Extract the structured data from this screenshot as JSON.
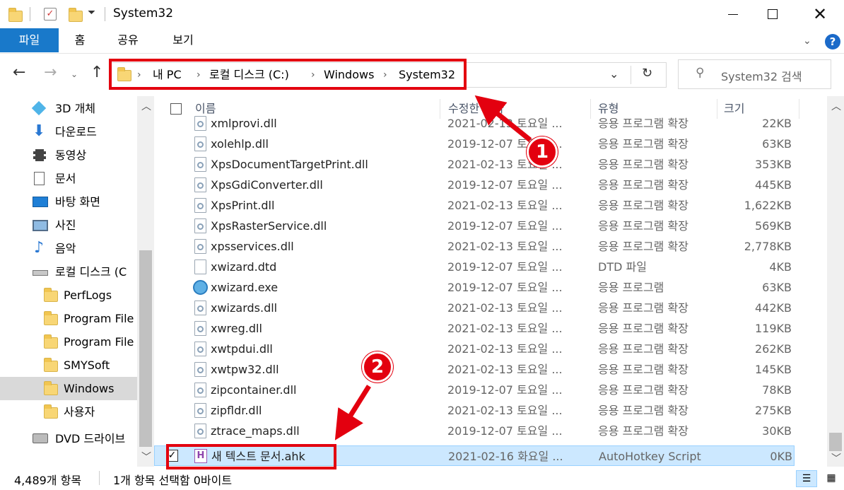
{
  "window": {
    "title": "System32",
    "minimize_icon": "minimize-icon",
    "maximize_icon": "maximize-icon",
    "close_icon": "close-icon"
  },
  "ribbon": {
    "tabs": [
      {
        "label": "파일",
        "active": true
      },
      {
        "label": "홈"
      },
      {
        "label": "공유"
      },
      {
        "label": "보기"
      }
    ],
    "help": "?"
  },
  "address": {
    "crumbs": [
      "내 PC",
      "로컬 디스크 (C:)",
      "Windows",
      "System32"
    ]
  },
  "search": {
    "placeholder": "System32 검색"
  },
  "sidebar": {
    "items": [
      {
        "label": "3D 개체",
        "icon": "3d-objects-icon"
      },
      {
        "label": "다운로드",
        "icon": "download-icon"
      },
      {
        "label": "동영상",
        "icon": "video-icon"
      },
      {
        "label": "문서",
        "icon": "document-icon"
      },
      {
        "label": "바탕 화면",
        "icon": "desktop-icon"
      },
      {
        "label": "사진",
        "icon": "pictures-icon"
      },
      {
        "label": "음악",
        "icon": "music-icon"
      },
      {
        "label": "로컬 디스크 (C",
        "icon": "drive-icon"
      },
      {
        "label": "PerfLogs",
        "icon": "folder-icon"
      },
      {
        "label": "Program File",
        "icon": "folder-icon"
      },
      {
        "label": "Program File",
        "icon": "folder-icon"
      },
      {
        "label": "SMYSoft",
        "icon": "folder-icon"
      },
      {
        "label": "Windows",
        "icon": "folder-icon",
        "selected": true
      },
      {
        "label": "사용자",
        "icon": "folder-icon"
      },
      {
        "label": "DVD 드라이브",
        "icon": "dvd-icon"
      }
    ]
  },
  "columns": {
    "name": "이름",
    "date": "수정한 날짜",
    "type": "유형",
    "size": "크기"
  },
  "files": [
    {
      "name": "xmlprovi.dll",
      "date": "2021-02-13 토요일 ...",
      "type": "응용 프로그램 확장",
      "size": "22KB"
    },
    {
      "name": "xolehlp.dll",
      "date": "2019-12-07 토요일 ...",
      "type": "응용 프로그램 확장",
      "size": "63KB"
    },
    {
      "name": "XpsDocumentTargetPrint.dll",
      "date": "2021-02-13 토요일 ...",
      "type": "응용 프로그램 확장",
      "size": "353KB"
    },
    {
      "name": "XpsGdiConverter.dll",
      "date": "2019-12-07 토요일 ...",
      "type": "응용 프로그램 확장",
      "size": "445KB"
    },
    {
      "name": "XpsPrint.dll",
      "date": "2021-02-13 토요일 ...",
      "type": "응용 프로그램 확장",
      "size": "1,622KB"
    },
    {
      "name": "XpsRasterService.dll",
      "date": "2019-12-07 토요일 ...",
      "type": "응용 프로그램 확장",
      "size": "569KB"
    },
    {
      "name": "xpsservices.dll",
      "date": "2021-02-13 토요일 ...",
      "type": "응용 프로그램 확장",
      "size": "2,778KB"
    },
    {
      "name": "xwizard.dtd",
      "date": "2019-12-07 토요일 ...",
      "type": "DTD 파일",
      "size": "4KB"
    },
    {
      "name": "xwizard.exe",
      "date": "2019-12-07 토요일 ...",
      "type": "응용 프로그램",
      "size": "63KB"
    },
    {
      "name": "xwizards.dll",
      "date": "2021-02-13 토요일 ...",
      "type": "응용 프로그램 확장",
      "size": "442KB"
    },
    {
      "name": "xwreg.dll",
      "date": "2021-02-13 토요일 ...",
      "type": "응용 프로그램 확장",
      "size": "119KB"
    },
    {
      "name": "xwtpdui.dll",
      "date": "2021-02-13 토요일 ...",
      "type": "응용 프로그램 확장",
      "size": "262KB"
    },
    {
      "name": "xwtpw32.dll",
      "date": "2021-02-13 토요일 ...",
      "type": "응용 프로그램 확장",
      "size": "145KB"
    },
    {
      "name": "zipcontainer.dll",
      "date": "2019-12-07 토요일 ...",
      "type": "응용 프로그램 확장",
      "size": "78KB"
    },
    {
      "name": "zipfldr.dll",
      "date": "2021-02-13 토요일 ...",
      "type": "응용 프로그램 확장",
      "size": "275KB"
    },
    {
      "name": "ztrace_maps.dll",
      "date": "2019-12-07 토요일 ...",
      "type": "응용 프로그램 확장",
      "size": "30KB"
    },
    {
      "name": "새 텍스트 문서.ahk",
      "date": "2021-02-16 화요일 ...",
      "type": "AutoHotkey Script",
      "size": "0KB",
      "selected": true
    }
  ],
  "status": {
    "count": "4,489개 항목",
    "selection": "1개 항목 선택함 0바이트"
  },
  "annotations": {
    "badge1": "1",
    "badge2": "2"
  },
  "colors": {
    "accent": "#1979ca",
    "highlight": "#e3000f",
    "selected_row": "#cce8ff",
    "selected_nav": "#d9d9d9"
  }
}
